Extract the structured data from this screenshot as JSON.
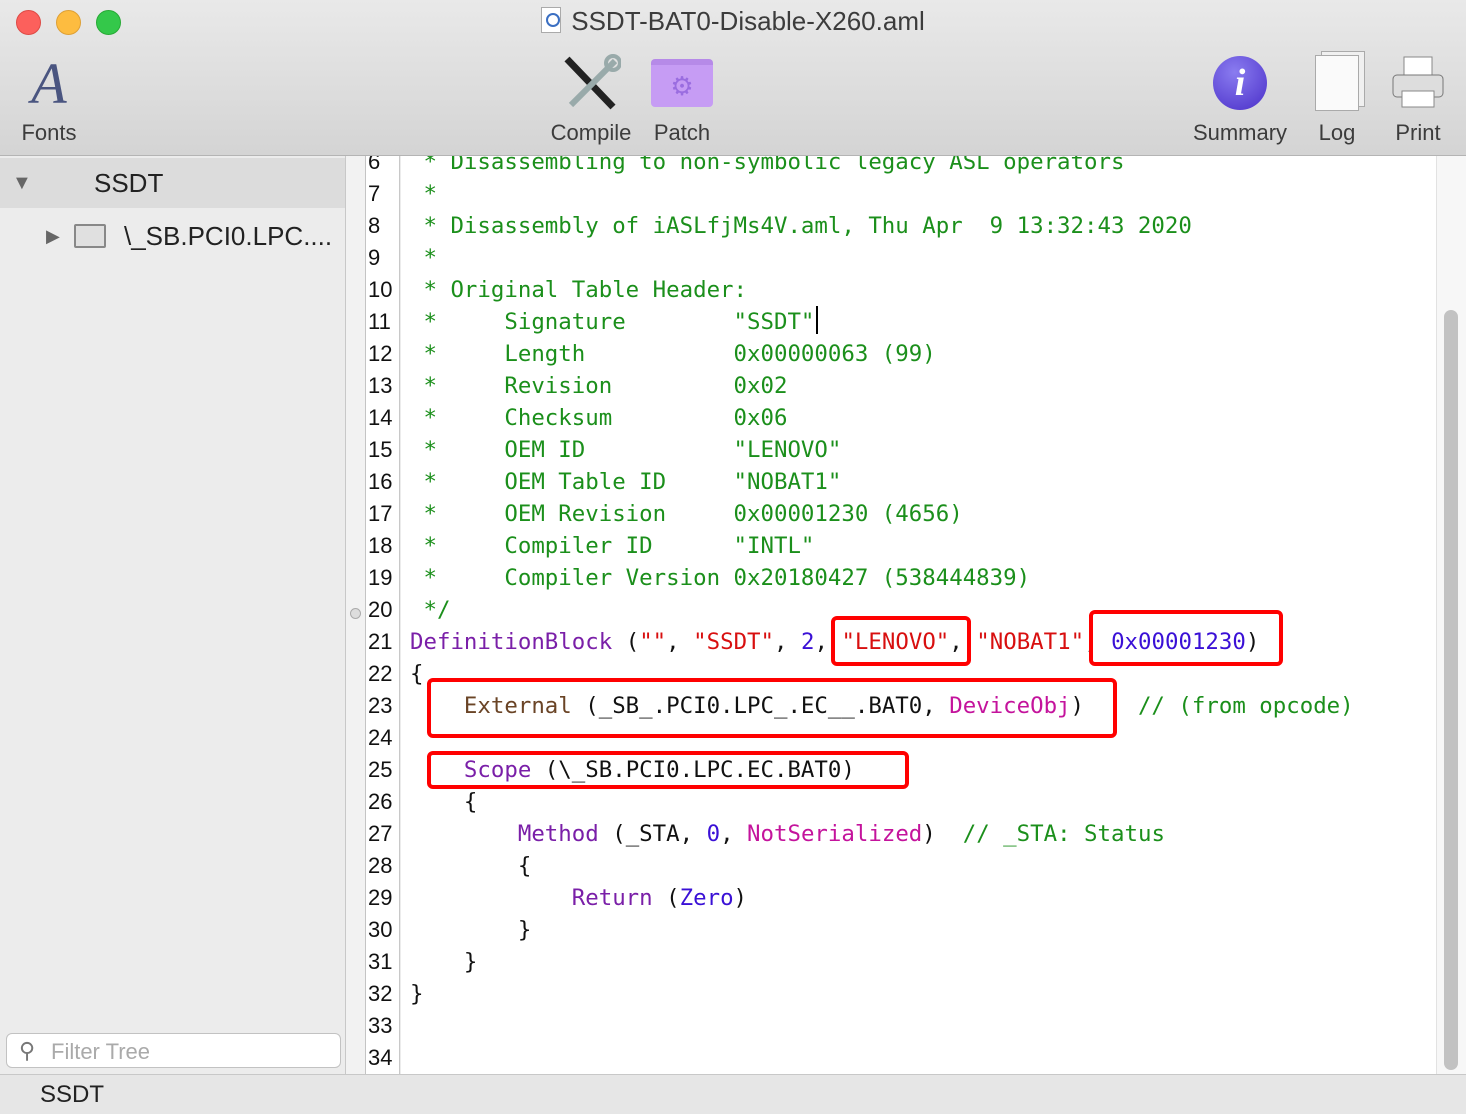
{
  "window": {
    "title": "SSDT-BAT0-Disable-X260.aml"
  },
  "toolbar": {
    "fonts": "Fonts",
    "compile": "Compile",
    "patch": "Patch",
    "summary": "Summary",
    "log": "Log",
    "print": "Print"
  },
  "sidebar": {
    "root": "SSDT",
    "child": "\\_SB.PCI0.LPC....",
    "filter_placeholder": "Filter Tree"
  },
  "status": "SSDT",
  "colors": {
    "comment": "#1b8f1b",
    "keyword": "#7a1fa8",
    "string": "#d80f0f",
    "number": "#3a10d6",
    "highlight_box": "#ff0000"
  },
  "code": [
    {
      "n": "6",
      "t": [
        [
          " * Disassembling to non-symbolic legacy ASL operators",
          "g"
        ]
      ]
    },
    {
      "n": "7",
      "t": [
        [
          " *",
          "g"
        ]
      ]
    },
    {
      "n": "8",
      "t": [
        [
          " * Disassembly of iASLfjMs4V.aml, Thu Apr  9 13:32:43 2020",
          "g"
        ]
      ]
    },
    {
      "n": "9",
      "t": [
        [
          " *",
          "g"
        ]
      ]
    },
    {
      "n": "10",
      "t": [
        [
          " * Original Table Header:",
          "g"
        ]
      ]
    },
    {
      "n": "11",
      "t": [
        [
          " *     Signature        \"SSDT\"",
          "g"
        ]
      ]
    },
    {
      "n": "12",
      "t": [
        [
          " *     Length           0x00000063 (99)",
          "g"
        ]
      ]
    },
    {
      "n": "13",
      "t": [
        [
          " *     Revision         0x02",
          "g"
        ]
      ]
    },
    {
      "n": "14",
      "t": [
        [
          " *     Checksum         0x06",
          "g"
        ]
      ]
    },
    {
      "n": "15",
      "t": [
        [
          " *     OEM ID           \"LENOVO\"",
          "g"
        ]
      ]
    },
    {
      "n": "16",
      "t": [
        [
          " *     OEM Table ID     \"NOBAT1\"",
          "g"
        ]
      ]
    },
    {
      "n": "17",
      "t": [
        [
          " *     OEM Revision     0x00001230 (4656)",
          "g"
        ]
      ]
    },
    {
      "n": "18",
      "t": [
        [
          " *     Compiler ID      \"INTL\"",
          "g"
        ]
      ]
    },
    {
      "n": "19",
      "t": [
        [
          " *     Compiler Version 0x20180427 (538444839)",
          "g"
        ]
      ]
    },
    {
      "n": "20",
      "t": [
        [
          " */",
          "g"
        ]
      ]
    },
    {
      "n": "21",
      "t": [
        [
          "DefinitionBlock",
          "k"
        ],
        [
          " (",
          "p"
        ],
        [
          "\"\"",
          "s"
        ],
        [
          ", ",
          "p"
        ],
        [
          "\"SSDT\"",
          "s"
        ],
        [
          ", ",
          "p"
        ],
        [
          "2",
          "n"
        ],
        [
          ", ",
          "p"
        ],
        [
          "\"LENOVO\"",
          "s"
        ],
        [
          ", ",
          "p"
        ],
        [
          "\"NOBAT1\"",
          "s"
        ],
        [
          ", ",
          "p"
        ],
        [
          "0x00001230",
          "n"
        ],
        [
          ")",
          "p"
        ]
      ]
    },
    {
      "n": "22",
      "t": [
        [
          "{",
          "p"
        ]
      ]
    },
    {
      "n": "23",
      "t": [
        [
          "    ",
          "p"
        ],
        [
          "External",
          "b"
        ],
        [
          " (_SB_.PCI0.LPC_.EC__.BAT0, ",
          "p"
        ],
        [
          "DeviceObj",
          "m"
        ],
        [
          ")    ",
          "p"
        ],
        [
          "// (from opcode)",
          "g"
        ]
      ]
    },
    {
      "n": "24",
      "t": []
    },
    {
      "n": "25",
      "t": [
        [
          "    ",
          "p"
        ],
        [
          "Scope",
          "k"
        ],
        [
          " (\\_SB.PCI0.LPC.EC.BAT0)",
          "p"
        ]
      ]
    },
    {
      "n": "26",
      "t": [
        [
          "    {",
          "p"
        ]
      ]
    },
    {
      "n": "27",
      "t": [
        [
          "        ",
          "p"
        ],
        [
          "Method",
          "k"
        ],
        [
          " (_STA, ",
          "p"
        ],
        [
          "0",
          "n"
        ],
        [
          ", ",
          "p"
        ],
        [
          "NotSerialized",
          "m"
        ],
        [
          ")  ",
          "p"
        ],
        [
          "// _STA: Status",
          "g"
        ]
      ]
    },
    {
      "n": "28",
      "t": [
        [
          "        {",
          "p"
        ]
      ]
    },
    {
      "n": "29",
      "t": [
        [
          "            ",
          "p"
        ],
        [
          "Return",
          "k"
        ],
        [
          " (",
          "p"
        ],
        [
          "Zero",
          "n"
        ],
        [
          ")",
          "p"
        ]
      ]
    },
    {
      "n": "30",
      "t": [
        [
          "        }",
          "p"
        ]
      ]
    },
    {
      "n": "31",
      "t": [
        [
          "    }",
          "p"
        ]
      ]
    },
    {
      "n": "32",
      "t": [
        [
          "}",
          "p"
        ]
      ]
    },
    {
      "n": "33",
      "t": []
    },
    {
      "n": "34",
      "t": []
    }
  ]
}
